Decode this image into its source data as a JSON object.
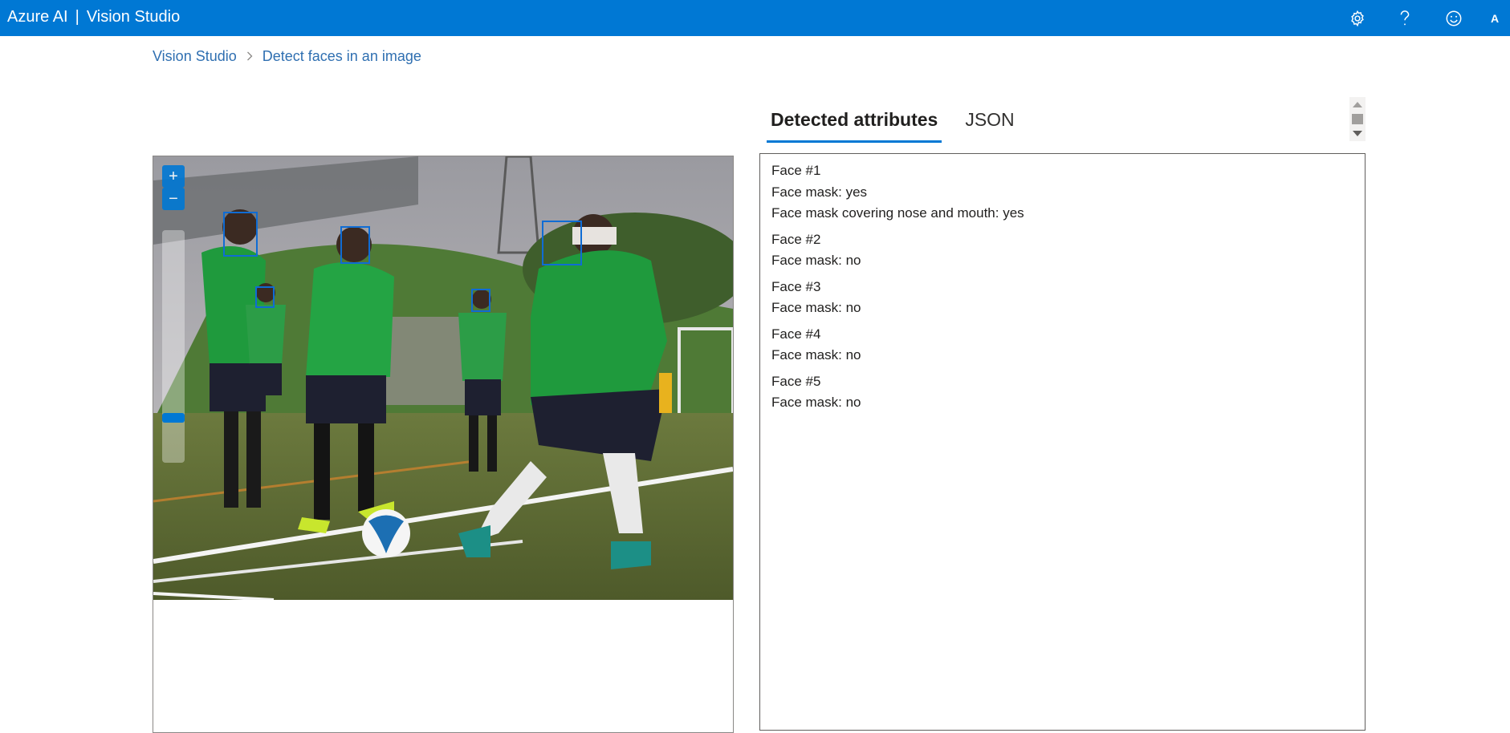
{
  "app": {
    "brand_name": "Azure AI",
    "separator": "|",
    "product_name": "Vision Studio",
    "user_initial": "A"
  },
  "header_icons": [
    "gear-icon",
    "help-icon",
    "feedback-smiley-icon"
  ],
  "breadcrumb": {
    "items": [
      "Vision Studio",
      "Detect faces in an image"
    ]
  },
  "tabs": [
    {
      "label": "Detected attributes",
      "active": true
    },
    {
      "label": "JSON",
      "active": false
    }
  ],
  "image": {
    "description_icon": "soccer-photo",
    "zoom_in_label": "+",
    "zoom_out_label": "−"
  },
  "faces": [
    {
      "title": "Face #1",
      "lines": [
        "Face mask: yes",
        "Face mask covering nose and mouth: yes"
      ]
    },
    {
      "title": "Face #2",
      "lines": [
        "Face mask: no"
      ]
    },
    {
      "title": "Face #3",
      "lines": [
        "Face mask: no"
      ]
    },
    {
      "title": "Face #4",
      "lines": [
        "Face mask: no"
      ]
    },
    {
      "title": "Face #5",
      "lines": [
        "Face mask: no"
      ]
    }
  ],
  "colors": {
    "accent": "#0078d4",
    "breadcrumb_link": "#2f6fb1",
    "face_box": "#0f6cd4"
  }
}
